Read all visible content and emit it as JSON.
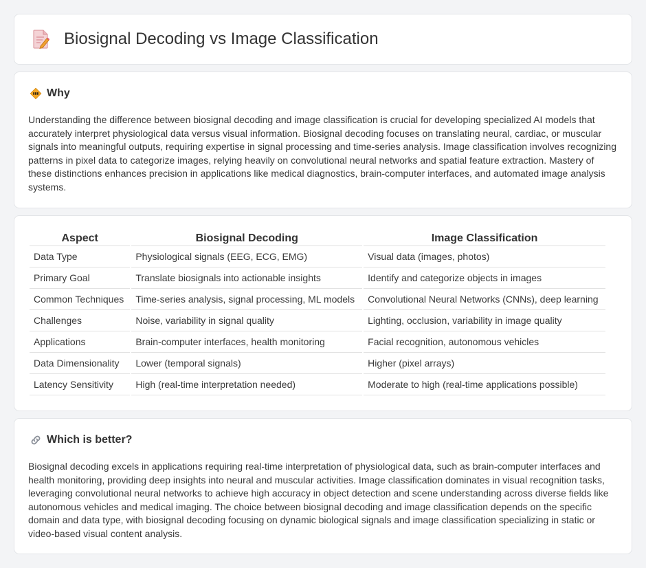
{
  "header": {
    "title": "Biosignal Decoding vs Image Classification",
    "icon": "document-pencil-icon"
  },
  "why": {
    "icon": "diamond-warning-icon",
    "title": "Why",
    "text": "Understanding the difference between biosignal decoding and image classification is crucial for developing specialized AI models that accurately interpret physiological data versus visual information. Biosignal decoding focuses on translating neural, cardiac, or muscular signals into meaningful outputs, requiring expertise in signal processing and time-series analysis. Image classification involves recognizing patterns in pixel data to categorize images, relying heavily on convolutional neural networks and spatial feature extraction. Mastery of these distinctions enhances precision in applications like medical diagnostics, brain-computer interfaces, and automated image analysis systems."
  },
  "comparison": {
    "headers": [
      "Aspect",
      "Biosignal Decoding",
      "Image Classification"
    ],
    "rows": [
      [
        "Data Type",
        "Physiological signals (EEG, ECG, EMG)",
        "Visual data (images, photos)"
      ],
      [
        "Primary Goal",
        "Translate biosignals into actionable insights",
        "Identify and categorize objects in images"
      ],
      [
        "Common Techniques",
        "Time-series analysis, signal processing, ML models",
        "Convolutional Neural Networks (CNNs), deep learning"
      ],
      [
        "Challenges",
        "Noise, variability in signal quality",
        "Lighting, occlusion, variability in image quality"
      ],
      [
        "Applications",
        "Brain-computer interfaces, health monitoring",
        "Facial recognition, autonomous vehicles"
      ],
      [
        "Data Dimensionality",
        "Lower (temporal signals)",
        "Higher (pixel arrays)"
      ],
      [
        "Latency Sensitivity",
        "High (real-time interpretation needed)",
        "Moderate to high (real-time applications possible)"
      ]
    ]
  },
  "better": {
    "icon": "link-icon",
    "title": "Which is better?",
    "text": "Biosignal decoding excels in applications requiring real-time interpretation of physiological data, such as brain-computer interfaces and health monitoring, providing deep insights into neural and muscular activities. Image classification dominates in visual recognition tasks, leveraging convolutional neural networks to achieve high accuracy in object detection and scene understanding across diverse fields like autonomous vehicles and medical imaging. The choice between biosignal decoding and image classification depends on the specific domain and data type, with biosignal decoding focusing on dynamic biological signals and image classification specializing in static or video-based visual content analysis."
  }
}
